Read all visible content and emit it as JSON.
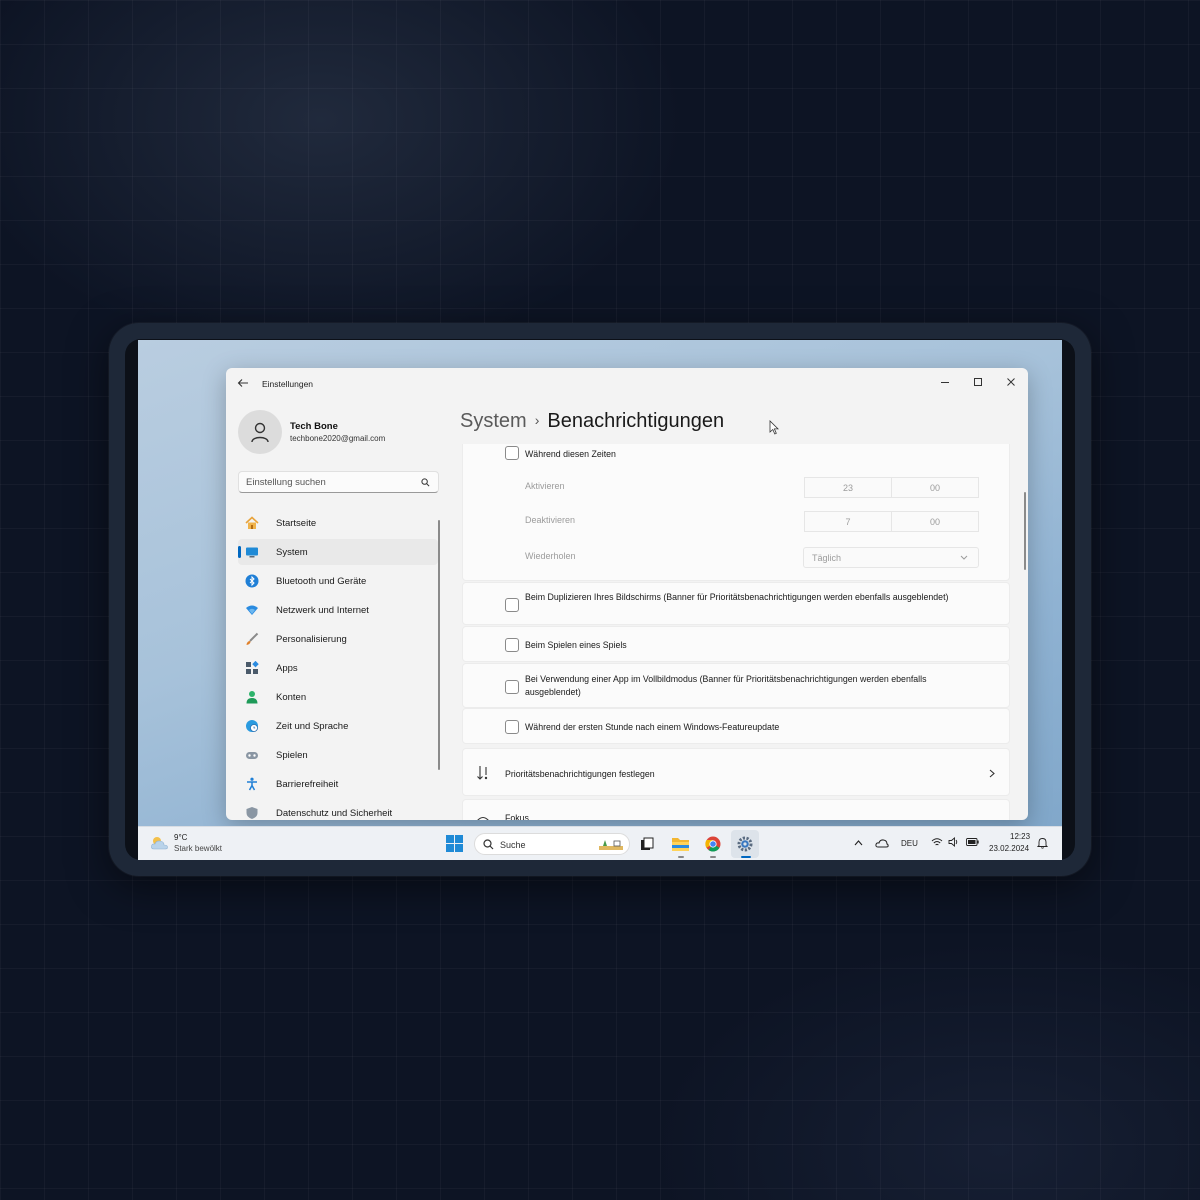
{
  "window": {
    "app_title": "Einstellungen",
    "breadcrumb_parent": "System",
    "breadcrumb_separator": "›",
    "breadcrumb_current": "Benachrichtigungen"
  },
  "profile": {
    "name": "Tech Bone",
    "email": "techbone2020@gmail.com"
  },
  "search": {
    "placeholder": "Einstellung suchen"
  },
  "nav": [
    {
      "label": "Startseite",
      "icon": "home-icon"
    },
    {
      "label": "System",
      "icon": "monitor-icon",
      "active": true
    },
    {
      "label": "Bluetooth und Geräte",
      "icon": "bluetooth-icon"
    },
    {
      "label": "Netzwerk und Internet",
      "icon": "wifi-icon"
    },
    {
      "label": "Personalisierung",
      "icon": "brush-icon"
    },
    {
      "label": "Apps",
      "icon": "apps-icon"
    },
    {
      "label": "Konten",
      "icon": "person-icon"
    },
    {
      "label": "Zeit und Sprache",
      "icon": "globe-clock-icon"
    },
    {
      "label": "Spielen",
      "icon": "gamepad-icon"
    },
    {
      "label": "Barrierefreiheit",
      "icon": "accessibility-icon"
    },
    {
      "label": "Datenschutz und Sicherheit",
      "icon": "shield-icon"
    }
  ],
  "schedule": {
    "label": "Während diesen Zeiten",
    "activate_label": "Aktivieren",
    "activate_hour": "23",
    "activate_minute": "00",
    "deactivate_label": "Deaktivieren",
    "deactivate_hour": "7",
    "deactivate_minute": "00",
    "repeat_label": "Wiederholen",
    "repeat_value": "Täglich"
  },
  "options": [
    "Beim Duplizieren Ihres Bildschirms (Banner für Prioritätsbenachrichtigungen werden ebenfalls ausgeblendet)",
    "Beim Spielen eines Spiels",
    "Bei Verwendung einer App im Vollbildmodus (Banner für Prioritätsbenachrichtigungen werden ebenfalls ausgeblendet)",
    "Während der ersten Stunde nach einem Windows-Featureupdate"
  ],
  "priority_row": {
    "label": "Prioritätsbenachrichtigungen festlegen"
  },
  "focus_row": {
    "label": "Fokus"
  },
  "taskbar": {
    "weather_temp": "9°C",
    "weather_desc": "Stark bewölkt",
    "search_label": "Suche",
    "language": "DEU",
    "time": "12:23",
    "date": "23.02.2024"
  },
  "colors": {
    "accent": "#0067c0"
  }
}
